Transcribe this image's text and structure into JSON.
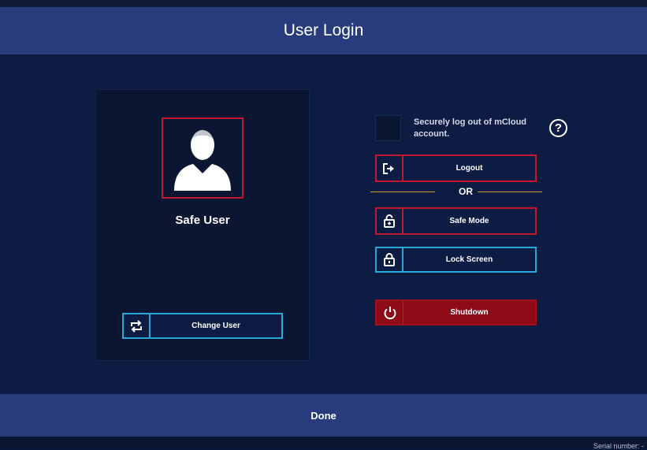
{
  "header": {
    "title": "User Login"
  },
  "user": {
    "name": "Safe User",
    "change_user_label": "Change User"
  },
  "logout_options": {
    "checkbox_label": "Securely log out of mCloud account.",
    "checked": false,
    "help_glyph": "?",
    "logout_label": "Logout",
    "or_label": "OR",
    "safe_mode_label": "Safe Mode",
    "lock_screen_label": "Lock Screen",
    "shutdown_label": "Shutdown"
  },
  "footer": {
    "done_label": "Done"
  },
  "status": {
    "serial_label": "Serial number: -"
  },
  "colors": {
    "header": "#283b7c",
    "background": "#0d1c42",
    "accent_red": "#c0182e",
    "accent_blue": "#2aa7d9",
    "shutdown_fill": "#8c0b17",
    "divider": "#c89b2a"
  },
  "icons": [
    "user-avatar-icon",
    "swap-icon",
    "logout-icon",
    "unlock-icon",
    "lock-icon",
    "power-icon",
    "help-icon"
  ]
}
